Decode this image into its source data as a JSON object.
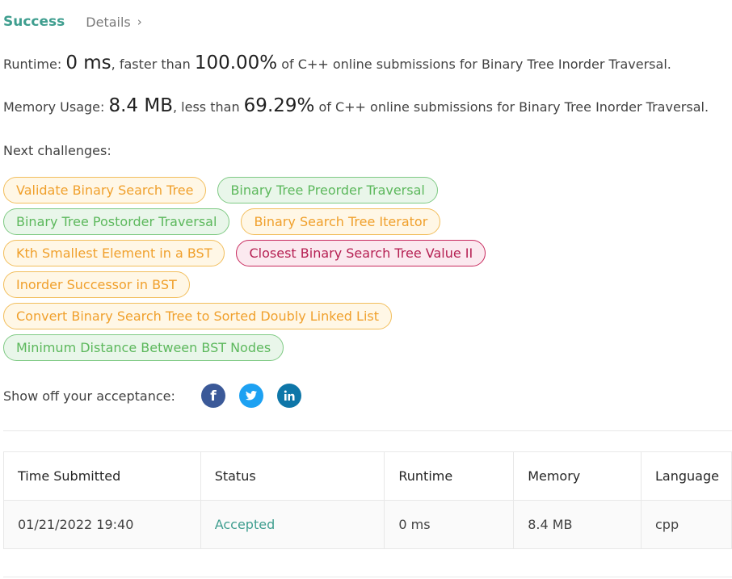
{
  "tabs": {
    "success": "Success",
    "details": "Details"
  },
  "runtime": {
    "label": "Runtime: ",
    "value": "0 ms",
    "mid": ", faster than ",
    "percent": "100.00%",
    "suffix": " of C++ online submissions for Binary Tree Inorder Traversal."
  },
  "memory": {
    "label": "Memory Usage: ",
    "value": "8.4 MB",
    "mid": ", less than ",
    "percent": "69.29%",
    "suffix": " of C++ online submissions for Binary Tree Inorder Traversal."
  },
  "next_label": "Next challenges:",
  "challenges": [
    {
      "label": "Validate Binary Search Tree",
      "difficulty": "medium"
    },
    {
      "label": "Binary Tree Preorder Traversal",
      "difficulty": "easy"
    },
    {
      "label": "Binary Tree Postorder Traversal",
      "difficulty": "easy"
    },
    {
      "label": "Binary Search Tree Iterator",
      "difficulty": "medium"
    },
    {
      "label": "Kth Smallest Element in a BST",
      "difficulty": "medium"
    },
    {
      "label": "Closest Binary Search Tree Value II",
      "difficulty": "hard"
    },
    {
      "label": "Inorder Successor in BST",
      "difficulty": "medium"
    },
    {
      "label": "Convert Binary Search Tree to Sorted Doubly Linked List",
      "difficulty": "medium"
    },
    {
      "label": "Minimum Distance Between BST Nodes",
      "difficulty": "easy"
    }
  ],
  "share": {
    "label": "Show off your acceptance:",
    "icons": [
      "facebook-icon",
      "twitter-icon",
      "linkedin-icon"
    ]
  },
  "table": {
    "headers": [
      "Time Submitted",
      "Status",
      "Runtime",
      "Memory",
      "Language"
    ],
    "rows": [
      [
        "01/21/2022 19:40",
        "Accepted",
        "0 ms",
        "8.4 MB",
        "cpp"
      ]
    ]
  },
  "colors": {
    "success": "#3f9e8f",
    "medium": "#f0a02c",
    "easy": "#5cb85c",
    "hard": "#b51f52"
  }
}
